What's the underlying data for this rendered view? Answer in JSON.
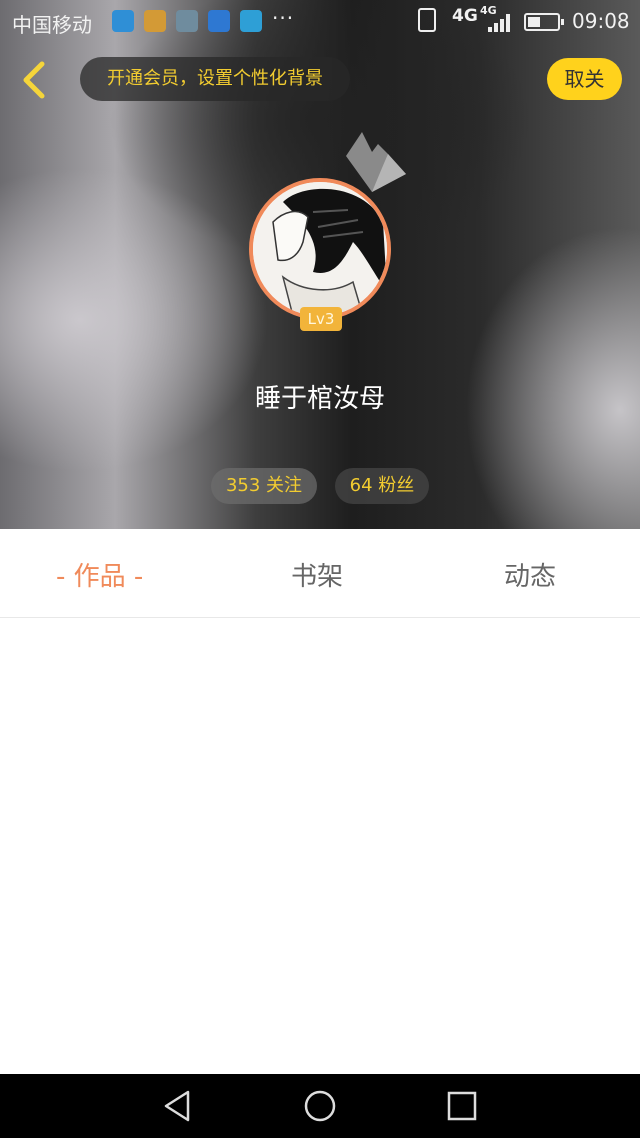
{
  "status_bar": {
    "carrier": "中国移动",
    "more": "···",
    "network_primary": "4G",
    "network_secondary": "4G",
    "time": "09:08"
  },
  "header": {
    "vip_banner": "开通会员，设置个性化背景",
    "unfollow_label": "取关"
  },
  "profile": {
    "level": "Lv3",
    "username": "睡于棺汝母",
    "following": "353 关注",
    "fans": "64 粉丝"
  },
  "tabs": [
    {
      "label": "- 作品 -"
    },
    {
      "label": "书架"
    },
    {
      "label": "动态"
    }
  ],
  "colors": {
    "accent": "#f08a5a",
    "yellow": "#ffd21c",
    "gold_text": "#f2cc30"
  }
}
